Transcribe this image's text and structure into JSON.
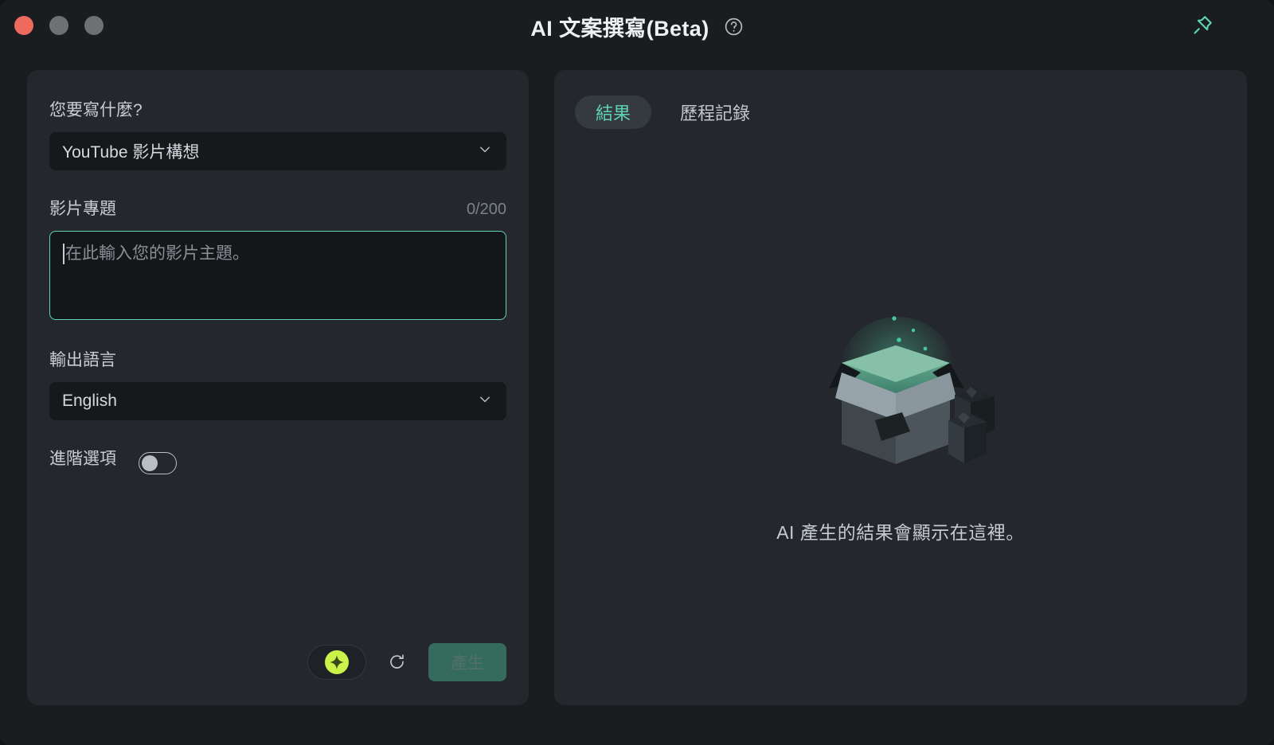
{
  "window": {
    "title": "AI 文案撰寫(Beta)",
    "help_icon": "question-circle-icon",
    "pin_icon": "pin-icon",
    "accent_color": "#5fd3b2",
    "background_color": "#1a1d20",
    "panel_color": "#24282c"
  },
  "traffic_lights": {
    "close_color": "#ec6a5e",
    "minimize_color": "#6e7073",
    "maximize_color": "#6e7073"
  },
  "form": {
    "type_label": "您要寫什麼?",
    "type_value": "YouTube 影片構想",
    "topic_label": "影片專題",
    "topic_counter": "0/200",
    "topic_value": "",
    "topic_placeholder": "在此輸入您的影片主題。",
    "language_label": "輸出語言",
    "language_value": "English",
    "advanced_label": "進階選項",
    "advanced_state": "off",
    "chevron_icon": "chevron-down-icon"
  },
  "actions": {
    "credit_icon": "sparkle-star-icon",
    "refresh_icon": "refresh-icon",
    "generate_label": "產生",
    "generate_color": "#346b5d"
  },
  "results": {
    "tabs": [
      {
        "label": "結果",
        "active": true
      },
      {
        "label": "歷程記錄",
        "active": false
      }
    ],
    "empty_illustration": "open-box-illustration",
    "empty_text": "AI 產生的結果會顯示在這裡。"
  }
}
